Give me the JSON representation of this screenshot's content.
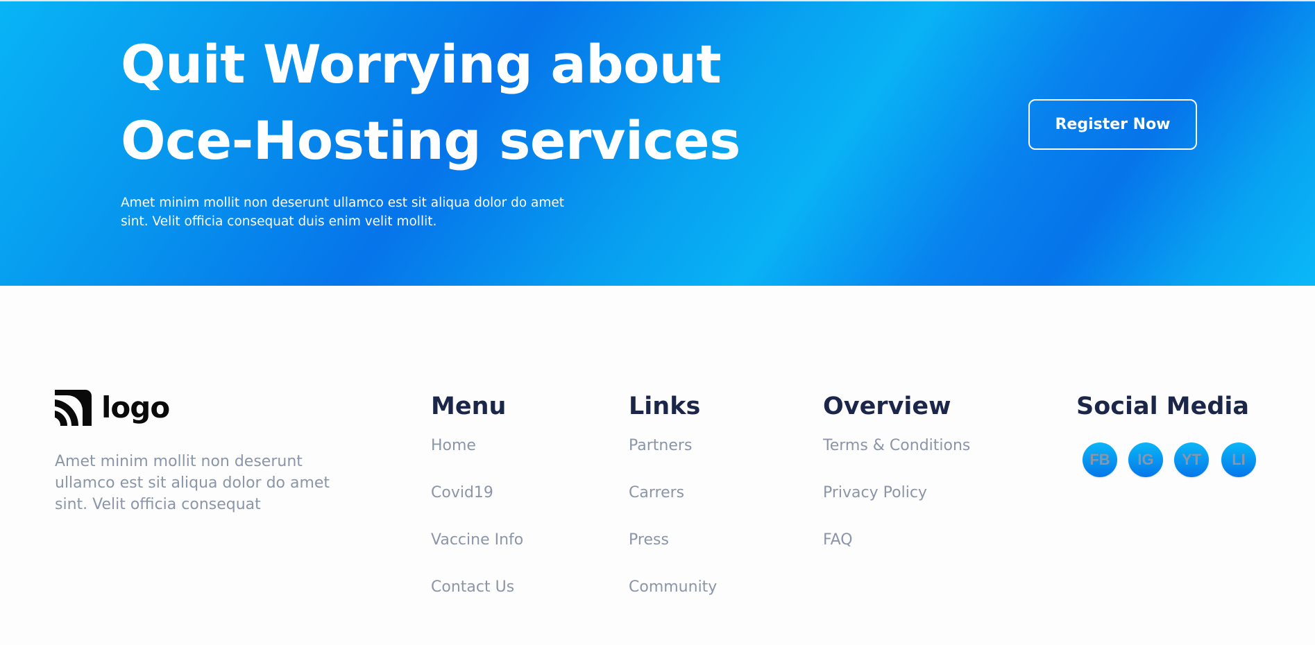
{
  "hero": {
    "title_line1": "Quit Worrying about",
    "title_line2": "Oce-Hosting services",
    "subtitle": "Amet minim mollit non deserunt ullamco est sit aliqua dolor do amet sint. Velit officia consequat duis enim velit mollit.",
    "register_label": "Register Now",
    "gradient_colors": [
      "#08b4f6",
      "#0674ea"
    ]
  },
  "footer": {
    "logo": {
      "icon": "logo-arcs-icon",
      "text": "logo"
    },
    "description": "Amet minim mollit non deserunt ullamco est sit aliqua dolor do amet sint. Velit officia consequat",
    "columns": {
      "menu": {
        "title": "Menu",
        "items": [
          "Home",
          "Covid19",
          "Vaccine Info",
          "Contact Us"
        ]
      },
      "links": {
        "title": "Links",
        "items": [
          "Partners",
          "Carrers",
          "Press",
          "Community"
        ]
      },
      "overview": {
        "title": "Overview",
        "items": [
          "Terms & Conditions",
          "Privacy Policy",
          "FAQ"
        ]
      },
      "social": {
        "title": "Social Media",
        "items": [
          {
            "label": "FB",
            "icon": "facebook-icon"
          },
          {
            "label": "IG",
            "icon": "instagram-icon"
          },
          {
            "label": "YT",
            "icon": "youtube-icon"
          },
          {
            "label": "LI",
            "icon": "linkedin-icon"
          }
        ]
      }
    },
    "heading_color": "#1b2648",
    "text_color": "#8b95a8"
  }
}
